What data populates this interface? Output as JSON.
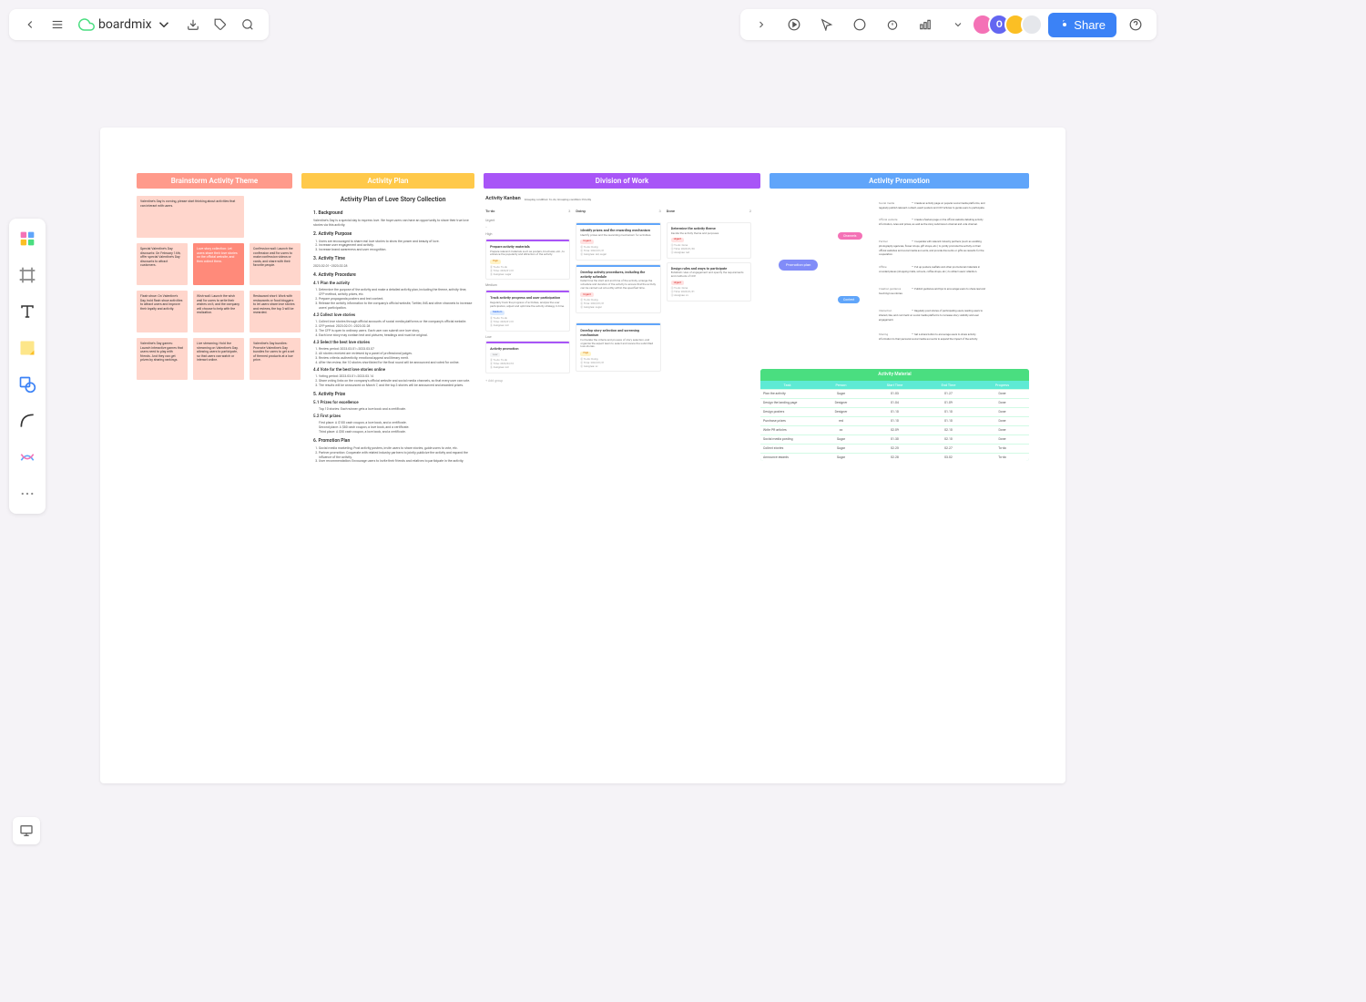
{
  "app": {
    "name": "boardmix"
  },
  "topbar": {
    "share": "Share"
  },
  "sections": {
    "brainstorm": "Brainstorm Activity Theme",
    "plan": "Activity Plan",
    "division": "Division of Work",
    "promotion": "Activity Promotion"
  },
  "brainstorm": {
    "intro": "Valentine's Day is coming, please start thinking about activities that can interact with users.",
    "notes": [
      "Special Valentine's Day discounts: On February 14th, offer special Valentine's Day discounts to attract customers.",
      "Love story collection: Let users share their love stories on the official website, and then collect them.",
      "Confession wall: Launch the confession wall for users to make confession videos or cards, and share with their favorite people.",
      "Flash show: On Valentine's Day, hold flash show activities to attract users and improve their loyalty and activity.",
      "Wish wall: Launch the wish wall for users to write their wishes on it, and the company will choose to help with the realization.",
      "Restaurant short: Work with restaurants or food bloggers to let users share love stories and reviews, the top 3 will be rewarded.",
      "Valentine's Day games: Launch interactive games that users need to play with friends. And they can get prizes by sharing rankings.",
      "Live streaming: Hold live streaming on Valentine's Day, allowing users to participate, so that users can watch or interact online.",
      "Valentine's Day bundles: Promote Valentine's Day bundles for users to get a set of themed products at a low price."
    ]
  },
  "plan": {
    "title": "Activity Plan of Love Story Collection",
    "s1": "1. Background",
    "s1t": "Valentine's Day is a special day to express love. We hope users can have an opportunity to share their true love stories via this activity.",
    "s2": "2. Activity Purpose",
    "s2l": [
      "Users are encouraged to share real love stories to show the power and beauty of love.",
      "Increase user engagement and activity.",
      "Increase brand awareness and user recognition."
    ],
    "s3": "3. Activity Time",
    "s3t": "2023.02.01–2023.02.28",
    "s4": "4. Activity Procedure",
    "s41": "4.1 Plan the activity",
    "s41l": [
      "Determine the purpose of the activity and make a detailed activity plan, including the theme, activity time, CFP method, activity prizes, etc.",
      "Prepare propaganda posters and text content.",
      "Release the activity information to the company's official website, Twitter, INS and other channels to increase users' participation."
    ],
    "s42": "4.2 Collect love stories",
    "s42l": [
      "Collect love stories through official accounts of social media platforms or the company's official website.",
      "CFP period: 2023.02.01~2023.02.28",
      "The CFP is open to ordinary users. Each user can submit one love story.",
      "Each love story may contain text and pictures; headings and must be original."
    ],
    "s43": "4.3 Select the best love stories",
    "s43l": [
      "Review period: 2023.03.01~2023.03.07",
      "All stories received are reviewed by a panel of professional judges.",
      "Review criteria: authenticity, emotional appeal and literary merit.",
      "After the review, the 10 stories shortlisted for the final round will be announced and voted for online."
    ],
    "s44": "4.4 Vote for the best love stories online",
    "s44l": [
      "Voting period: 2023.03.01~2023.03.14",
      "Share voting links on the company's official website and social media channels, so that every user can vote.",
      "The results will be announced on March 7, and the top 3 stories will be announced and awarded prizes."
    ],
    "s5": "5. Activity Prize",
    "s51": "5.1 Prizes for excellence",
    "s51t": "Top 10 stories: Each winner gets a love book and a certificate.",
    "s52": "5.2 First prizes",
    "s52l": [
      "First place: A $100 cash coupon, a love book, and a certificate.",
      "Second place: A $80 cash coupon, a love book, and a certificate.",
      "Third place: A $50 cash coupon, a love book, and a certificate."
    ],
    "s6": "6. Promotion Plan",
    "s6l": [
      "Social media marketing: Post activity posters, invite users to share stories, guide users to vote, etc.",
      "Partner promotion: Cooperate with related industry partners to jointly publicize the activity and expand the influence of the activity.",
      "User recommendation: Encourage users to invite their friends and relatives to participate in the activity."
    ]
  },
  "kanban": {
    "title": "Activity Kanban",
    "meta": "Grouping condition: To-do; Grouping condition: Priority",
    "cols": [
      "To-do",
      "Doing",
      "Done"
    ],
    "counts": [
      "3",
      "3",
      "2"
    ],
    "groups": {
      "urgent": "Urgent",
      "high": "High",
      "medium": "Medium",
      "low": "Low"
    },
    "cards": {
      "doing1": {
        "title": "Identify prizes and the rewarding mechanism",
        "desc": "Identify prizes and the rewarding mechanism for activities.",
        "tag": "Urgent",
        "meta": [
          "To-do: Doing",
          "Time: 2023/01/31",
          "Assignee: red, sugar"
        ]
      },
      "done1": {
        "title": "Determine the activity theme",
        "desc": "Decide the activity theme and purposes.",
        "tag": "Urgent",
        "meta": [
          "To-do: Done",
          "Time: 2023/01/30",
          "Assignee: red"
        ]
      },
      "doing2": {
        "title": "Develop activity procedures, including the activity schedule",
        "desc": "Determine the start and end time of the activity, arrange the schedule and duration of the activity to ensure that the activity can be carried out smoothly within the specified time.",
        "tag": "Urgent",
        "meta": [
          "To-do: Doing",
          "Time: 2023/01/31",
          "Assignee: sugar"
        ]
      },
      "done2": {
        "title": "Design rules and ways to participate",
        "desc": "Establish rules of engagement and specify the requirements and methods of CFP.",
        "tag": "Urgent",
        "meta": [
          "To-do: Done",
          "Time: 2023/01/31",
          "Assignee: xx"
        ]
      },
      "todo1": {
        "title": "Prepare activity materials",
        "desc": "Prepare relevant materials such as posters, brochures, etc., to enhance the popularity and attraction of the activity.",
        "tag": "High",
        "meta": [
          "To-do: To-do",
          "Time: 2023/01/31",
          "Assignee: sugar"
        ]
      },
      "doing3": {
        "title": "Develop story selection and screening mechanism",
        "desc": "Formulate the criteria and process of story selection, and organize the expert team to select and review the submitted love stories.",
        "tag": "High",
        "meta": [
          "To-do: Doing",
          "Time: 2023/01/31",
          "Assignee: xx"
        ]
      },
      "todo2": {
        "title": "Track activity progress and user participation",
        "desc": "Regularly track the progress of activities, analyze the user participation, adjust and optimize the activity strategy in time.",
        "tag": "Medium",
        "meta": [
          "To-do: To-do",
          "Time: 2023/01/31",
          "Assignee: red"
        ]
      },
      "todo3": {
        "title": "Activity promotion",
        "desc": "",
        "tag": "Low",
        "meta": [
          "To-do: To-do",
          "Time: 2023/02/10",
          "Assignee: red"
        ]
      }
    },
    "addgroup": "+ Add group"
  },
  "mindmap": {
    "root": "Promotion plan",
    "b1": "Channels",
    "b2": "Content",
    "leaves": [
      {
        "label": "Social media",
        "text": "Create an activity page on popular social media platforms, and regularly publish relevant content, event posters and CFP articles to guide users to participate."
      },
      {
        "label": "Official website",
        "text": "Create a feature page on the official website detailing activity information, rules and prizes, as well as the story submission channel and vote channel."
      },
      {
        "label": "Partner",
        "text": "Cooperate with relevant industry partners (such as wedding photography agencies, flower shops, gift shops, etc.) to jointly promote the activity on their official websites and social media accounts, and provide discounts or gifts as rewards for the cooperation."
      },
      {
        "label": "Offline",
        "text": "Put up posters, leaflets and other promotional materials in crowded places (shopping malls, schools, coffee shops, etc.) to attract users' attention."
      },
      {
        "label": "Creation guidance",
        "text": "Publish guidance and tips to encourage users to share real and touching love stories."
      },
      {
        "label": "Interaction",
        "text": "Regularly post stories of participating users, leading users to interact, like, and comment on social media platforms to increase story visibility and user engagement."
      },
      {
        "label": "Sharing",
        "text": "Set a share button to encourage users to share activity information to their personal social media accounts to expand the impact of the activity."
      }
    ]
  },
  "material": {
    "title": "Activity Material",
    "headers": [
      "Task",
      "Person",
      "Start Time",
      "End Time",
      "Progress"
    ],
    "rows": [
      [
        "Plan the activity",
        "Sugar",
        "01.03",
        "01.27",
        "Done"
      ],
      [
        "Design the landing page",
        "Designer",
        "01.04",
        "01.09",
        "Done"
      ],
      [
        "Design posters",
        "Designer",
        "01.10",
        "01.10",
        "Done"
      ],
      [
        "Purchase prizes",
        "red",
        "01.10",
        "01.10",
        "Done"
      ],
      [
        "Write PR articles",
        "xx",
        "02.09",
        "02.10",
        "Done"
      ],
      [
        "Social media posting",
        "Sugar",
        "01.30",
        "02.10",
        "Done"
      ],
      [
        "Collect stories",
        "Sugar",
        "02.25",
        "02.27",
        "To-do"
      ],
      [
        "Announce awards",
        "Sugar",
        "02.28",
        "03.02",
        "To-do"
      ]
    ]
  }
}
